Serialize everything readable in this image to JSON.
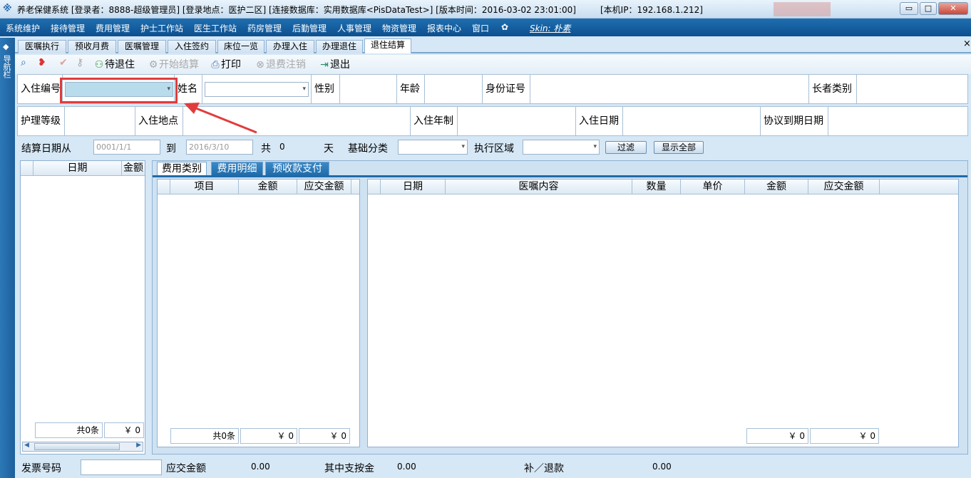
{
  "titlebar": {
    "text": "养老保健系统  [登录者：8888-超级管理员]  [登录地点：医护二区]  [连接数据库：实用数据库<PisDataTest>]  [版本时间：2016-03-02 23:01:00]",
    "ip": "[本机IP：192.168.1.212]",
    "min": "▭",
    "max": "□",
    "close": "✕"
  },
  "menu": {
    "items": [
      "系统维护",
      "接待管理",
      "费用管理",
      "护士工作站",
      "医生工作站",
      "药房管理",
      "后勤管理",
      "人事管理",
      "物资管理",
      "报表中心",
      "窗口"
    ],
    "skin": "Skin: 朴素"
  },
  "leftstrip": {
    "label": "导航栏"
  },
  "tabs": [
    "医嘱执行",
    "预收月费",
    "医嘱管理",
    "入住签约",
    "床位一览",
    "办理入住",
    "办理退住",
    "退住结算"
  ],
  "tab_close": "×",
  "toolbar": {
    "pending": "待退住",
    "start": "开始结算",
    "print": "打印",
    "cancel": "退费注销",
    "exit": "退出"
  },
  "form": {
    "admission_no": "入住编号",
    "name": "姓名",
    "gender": "性别",
    "age": "年龄",
    "id_no": "身份证号",
    "elder_type": "长者类别",
    "care_level": "护理等级",
    "location": "入住地点",
    "term": "入住年制",
    "date": "入住日期",
    "due_date": "协议到期日期"
  },
  "filter": {
    "date_from": "结算日期从",
    "from_value": "0001/1/1",
    "to": "到",
    "to_value": "2016/3/10",
    "total": "共",
    "days": "0",
    "days_unit": "天",
    "category": "基础分类",
    "area": "执行区域",
    "filter_btn": "过滤",
    "show_all_btn": "显示全部"
  },
  "left_grid": {
    "headers": [
      "日期",
      "金额"
    ],
    "count": "共0条",
    "amount": "￥ 0"
  },
  "subtabs": [
    "费用类别",
    "费用明细",
    "预收款支付"
  ],
  "mid_grid": {
    "headers": [
      "项目",
      "金额",
      "应交金额"
    ],
    "count": "共0条",
    "amount": "￥ 0",
    "due": "￥ 0"
  },
  "right_grid": {
    "headers": [
      "日期",
      "医嘱内容",
      "数量",
      "单价",
      "金额",
      "应交金额"
    ],
    "amount": "￥ 0",
    "due": "￥ 0"
  },
  "bottom": {
    "invoice": "发票号码",
    "due_label": "应交金额",
    "due_value": "0.00",
    "prepaid_label": "其中支按金",
    "prepaid_value": "0.00",
    "refund_label": "补／退款",
    "refund_value": "0.00"
  },
  "colors": {
    "accent": "#1f6fb0",
    "highlight": "#e03c3c"
  }
}
